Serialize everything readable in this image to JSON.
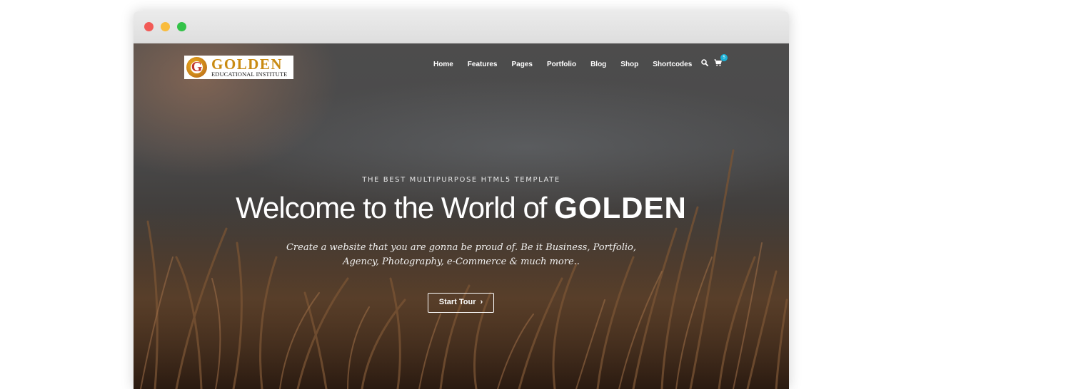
{
  "window": {
    "controls": [
      "close",
      "minimize",
      "maximize"
    ]
  },
  "logo": {
    "title": "GOLDEN",
    "subtitle": "EDUCATIONAL INSTITUTE",
    "mark": "G"
  },
  "nav": {
    "items": [
      {
        "label": "Home"
      },
      {
        "label": "Features"
      },
      {
        "label": "Pages"
      },
      {
        "label": "Portfolio"
      },
      {
        "label": "Blog"
      },
      {
        "label": "Shop"
      },
      {
        "label": "Shortcodes"
      }
    ],
    "search_icon": "search-icon",
    "cart_icon": "cart-icon",
    "cart_count": "5"
  },
  "hero": {
    "eyebrow": "THE BEST MULTIPURPOSE HTML5 TEMPLATE",
    "headline": "Welcome to the World of ",
    "headline_brand": "GOLDEN",
    "subtext_line1": "Create a website that you are gonna be proud of. Be it Business, Portfolio,",
    "subtext_line2": "Agency, Photography, e-Commerce & much more..",
    "cta_label": "Start Tour",
    "cta_icon": "chevron-right-icon"
  },
  "colors": {
    "accent": "#1ab0d6",
    "brand_gold": "#c98b12",
    "logo_red": "#c0362c",
    "close": "#f25a56",
    "minimize": "#f9bc3d",
    "maximize": "#33c248"
  }
}
